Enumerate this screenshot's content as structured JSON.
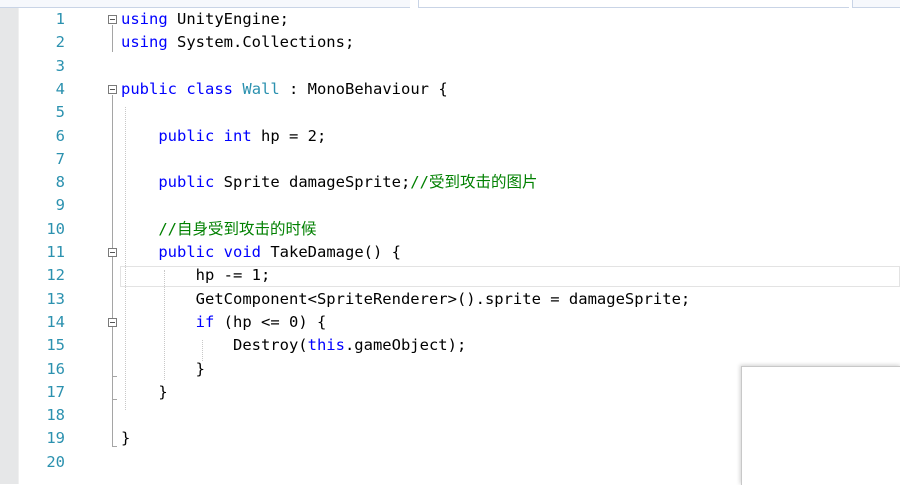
{
  "editor": {
    "lines": [
      {
        "n": "1",
        "tokens": [
          {
            "t": "using",
            "c": "kw"
          },
          {
            "t": " UnityEngine;"
          }
        ]
      },
      {
        "n": "2",
        "tokens": [
          {
            "t": "using",
            "c": "kw"
          },
          {
            "t": " System.Collections;"
          }
        ]
      },
      {
        "n": "3",
        "tokens": []
      },
      {
        "n": "4",
        "tokens": [
          {
            "t": "public",
            "c": "kw"
          },
          {
            "t": " "
          },
          {
            "t": "class",
            "c": "kw"
          },
          {
            "t": " "
          },
          {
            "t": "Wall",
            "c": "ty"
          },
          {
            "t": " : MonoBehaviour {"
          }
        ]
      },
      {
        "n": "5",
        "tokens": []
      },
      {
        "n": "6",
        "tokens": [
          {
            "t": "    "
          },
          {
            "t": "public",
            "c": "kw"
          },
          {
            "t": " "
          },
          {
            "t": "int",
            "c": "kw"
          },
          {
            "t": " hp = 2;"
          }
        ]
      },
      {
        "n": "7",
        "tokens": []
      },
      {
        "n": "8",
        "tokens": [
          {
            "t": "    "
          },
          {
            "t": "public",
            "c": "kw"
          },
          {
            "t": " Sprite damageSprite;"
          },
          {
            "t": "//受到攻击的图片",
            "c": "cm"
          }
        ]
      },
      {
        "n": "9",
        "tokens": []
      },
      {
        "n": "10",
        "tokens": [
          {
            "t": "    "
          },
          {
            "t": "//自身受到攻击的时候",
            "c": "cm"
          }
        ]
      },
      {
        "n": "11",
        "tokens": [
          {
            "t": "    "
          },
          {
            "t": "public",
            "c": "kw"
          },
          {
            "t": " "
          },
          {
            "t": "void",
            "c": "kw"
          },
          {
            "t": " TakeDamage() {"
          }
        ]
      },
      {
        "n": "12",
        "tokens": [
          {
            "t": "        hp -= 1;"
          }
        ]
      },
      {
        "n": "13",
        "tokens": [
          {
            "t": "        GetComponent<SpriteRenderer>().sprite = damageSprite;"
          }
        ]
      },
      {
        "n": "14",
        "tokens": [
          {
            "t": "        "
          },
          {
            "t": "if",
            "c": "kw"
          },
          {
            "t": " (hp <= 0) {"
          }
        ]
      },
      {
        "n": "15",
        "tokens": [
          {
            "t": "            Destroy("
          },
          {
            "t": "this",
            "c": "kw"
          },
          {
            "t": ".gameObject);"
          }
        ]
      },
      {
        "n": "16",
        "tokens": [
          {
            "t": "        }"
          }
        ]
      },
      {
        "n": "17",
        "tokens": [
          {
            "t": "    }"
          }
        ]
      },
      {
        "n": "18",
        "tokens": []
      },
      {
        "n": "19",
        "tokens": [
          {
            "t": "}"
          }
        ]
      },
      {
        "n": "20",
        "tokens": []
      }
    ]
  }
}
